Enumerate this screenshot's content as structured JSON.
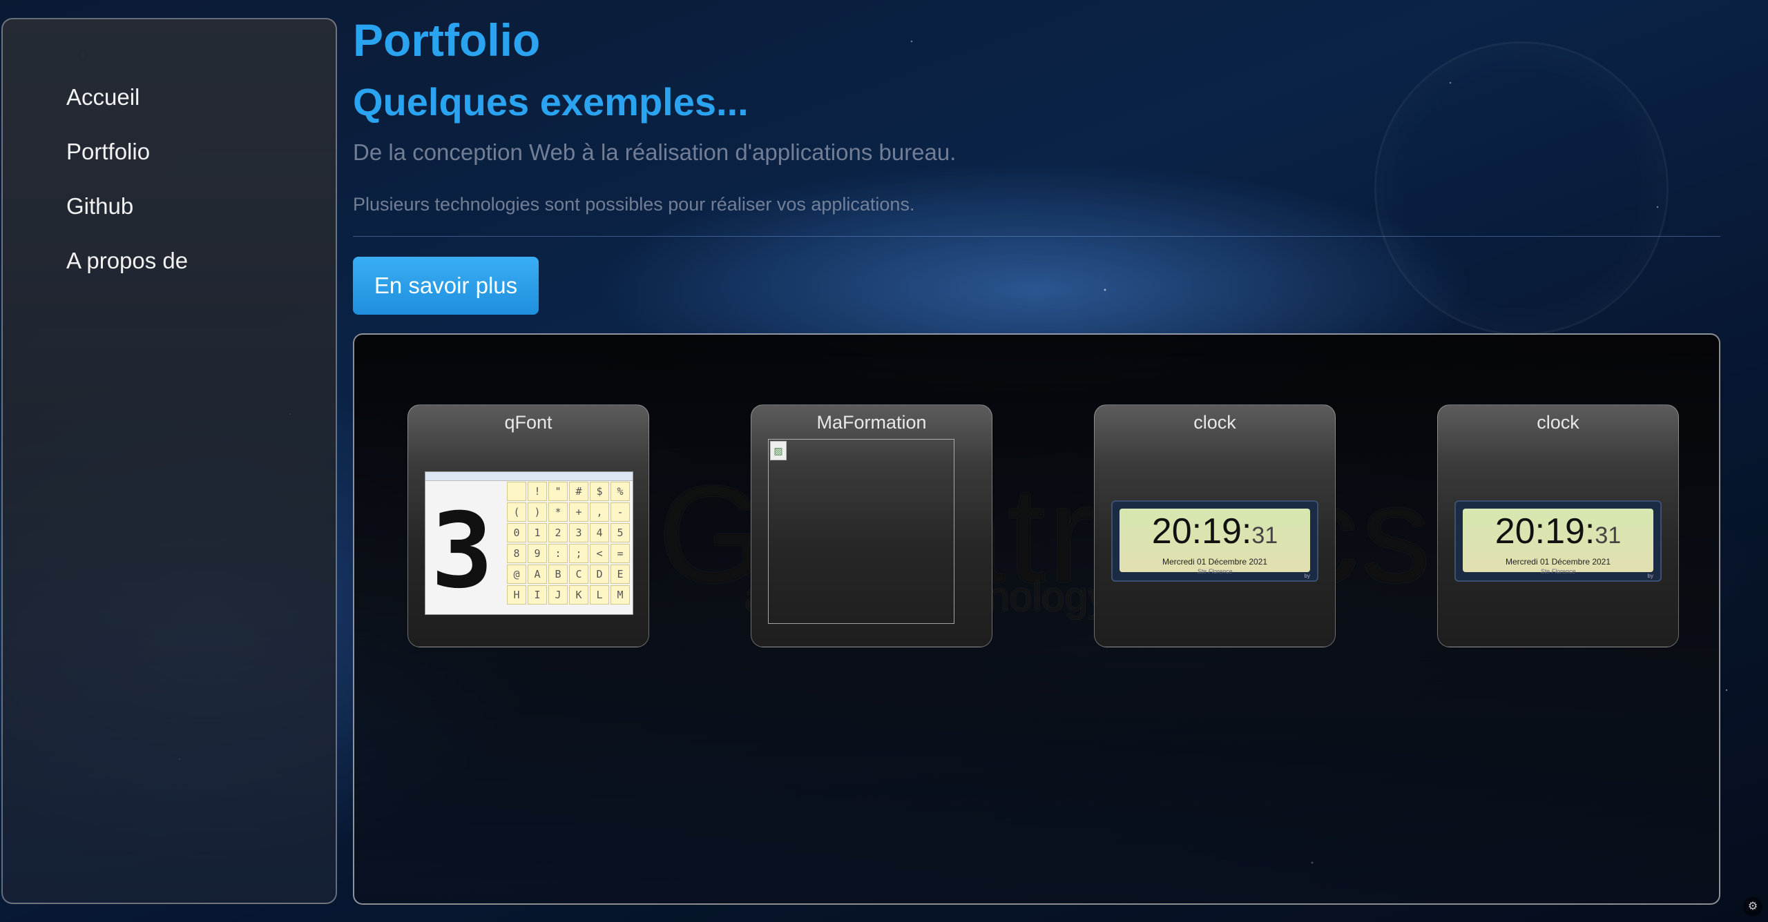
{
  "sidebar": {
    "items": [
      {
        "label": "Accueil"
      },
      {
        "label": "Portfolio"
      },
      {
        "label": "Github"
      },
      {
        "label": "A propos de"
      }
    ]
  },
  "header": {
    "title": "Portfolio",
    "subtitle": "Quelques exemples...",
    "lead": "De la conception Web à la réalisation d'applications bureau.",
    "info": "Plusieurs technologies sont possibles pour réaliser vos applications.",
    "cta_label": "En savoir plus"
  },
  "gallery": {
    "watermark": "Genatronics",
    "watermark_sub": "a part of technology",
    "cards": [
      {
        "title": "qFont",
        "thumb": "qfont-screenshot",
        "digit": "3",
        "glyphs": [
          "",
          "!",
          "\"",
          "#",
          "$",
          "%",
          "(",
          ")",
          "*",
          "+",
          ",",
          "-",
          "0",
          "1",
          "2",
          "3",
          "4",
          "5",
          "8",
          "9",
          ":",
          ";",
          "<",
          "=",
          "@",
          "A",
          "B",
          "C",
          "D",
          "E",
          "H",
          "I",
          "J",
          "K",
          "L",
          "M"
        ]
      },
      {
        "title": "MaFormation",
        "thumb": "broken-image"
      },
      {
        "title": "clock",
        "thumb": "clock-screenshot",
        "time": "20:19:",
        "seconds": "31",
        "date": "Mercredi 01 Décembre 2021",
        "name": "Ste Florence",
        "by": "by"
      },
      {
        "title": "clock",
        "thumb": "clock-screenshot",
        "time": "20:19:",
        "seconds": "31",
        "date": "Mercredi 01 Décembre 2021",
        "name": "Ste Florence",
        "by": "by"
      }
    ]
  },
  "colors": {
    "accent": "#2aa3f0",
    "button": "#2a9fe8",
    "background": "#0a2347"
  },
  "icons": {
    "corner": "settings-icon"
  }
}
